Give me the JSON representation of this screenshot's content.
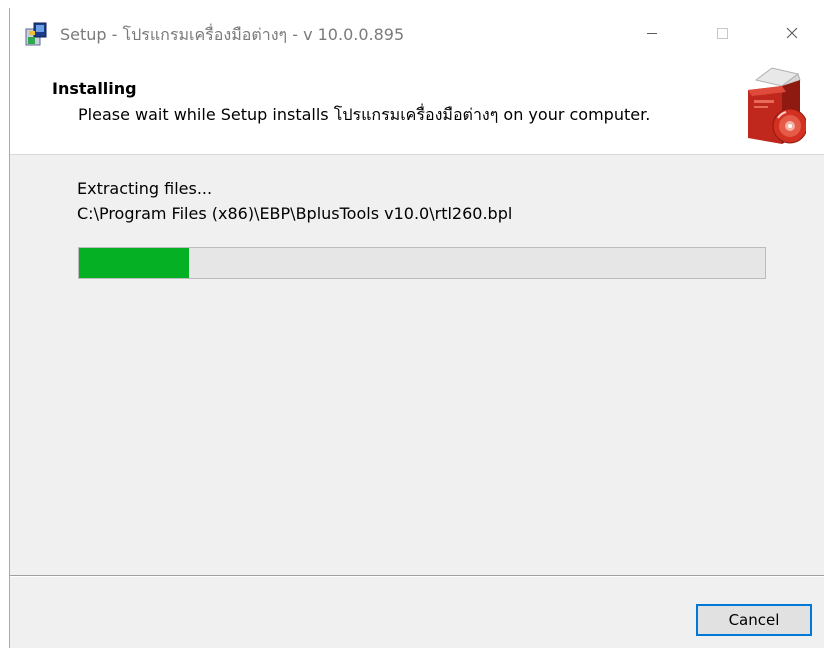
{
  "window": {
    "title": "Setup - โปรแกรมเครื่องมือต่างๆ - v 10.0.0.895",
    "app_icon": "setup-box-icon",
    "controls": {
      "minimize_icon": "minimize-icon",
      "maximize_icon": "maximize-icon",
      "close_icon": "close-icon"
    }
  },
  "header": {
    "title": "Installing",
    "subtitle": "Please wait while Setup installs โปรแกรมเครื่องมือต่างๆ on your computer.",
    "icon": "installer-box-cd-icon"
  },
  "status": {
    "line1": "Extracting files...",
    "line2": "C:\\Program Files (x86)\\EBP\\BplusTools v10.0\\rtl260.bpl"
  },
  "progress": {
    "percent": 16,
    "color": "#06b025"
  },
  "footer": {
    "cancel_label": "Cancel"
  },
  "colors": {
    "accent": "#0078d7",
    "progress_fill": "#06b025",
    "dialog_bg": "#f0f0f0"
  }
}
